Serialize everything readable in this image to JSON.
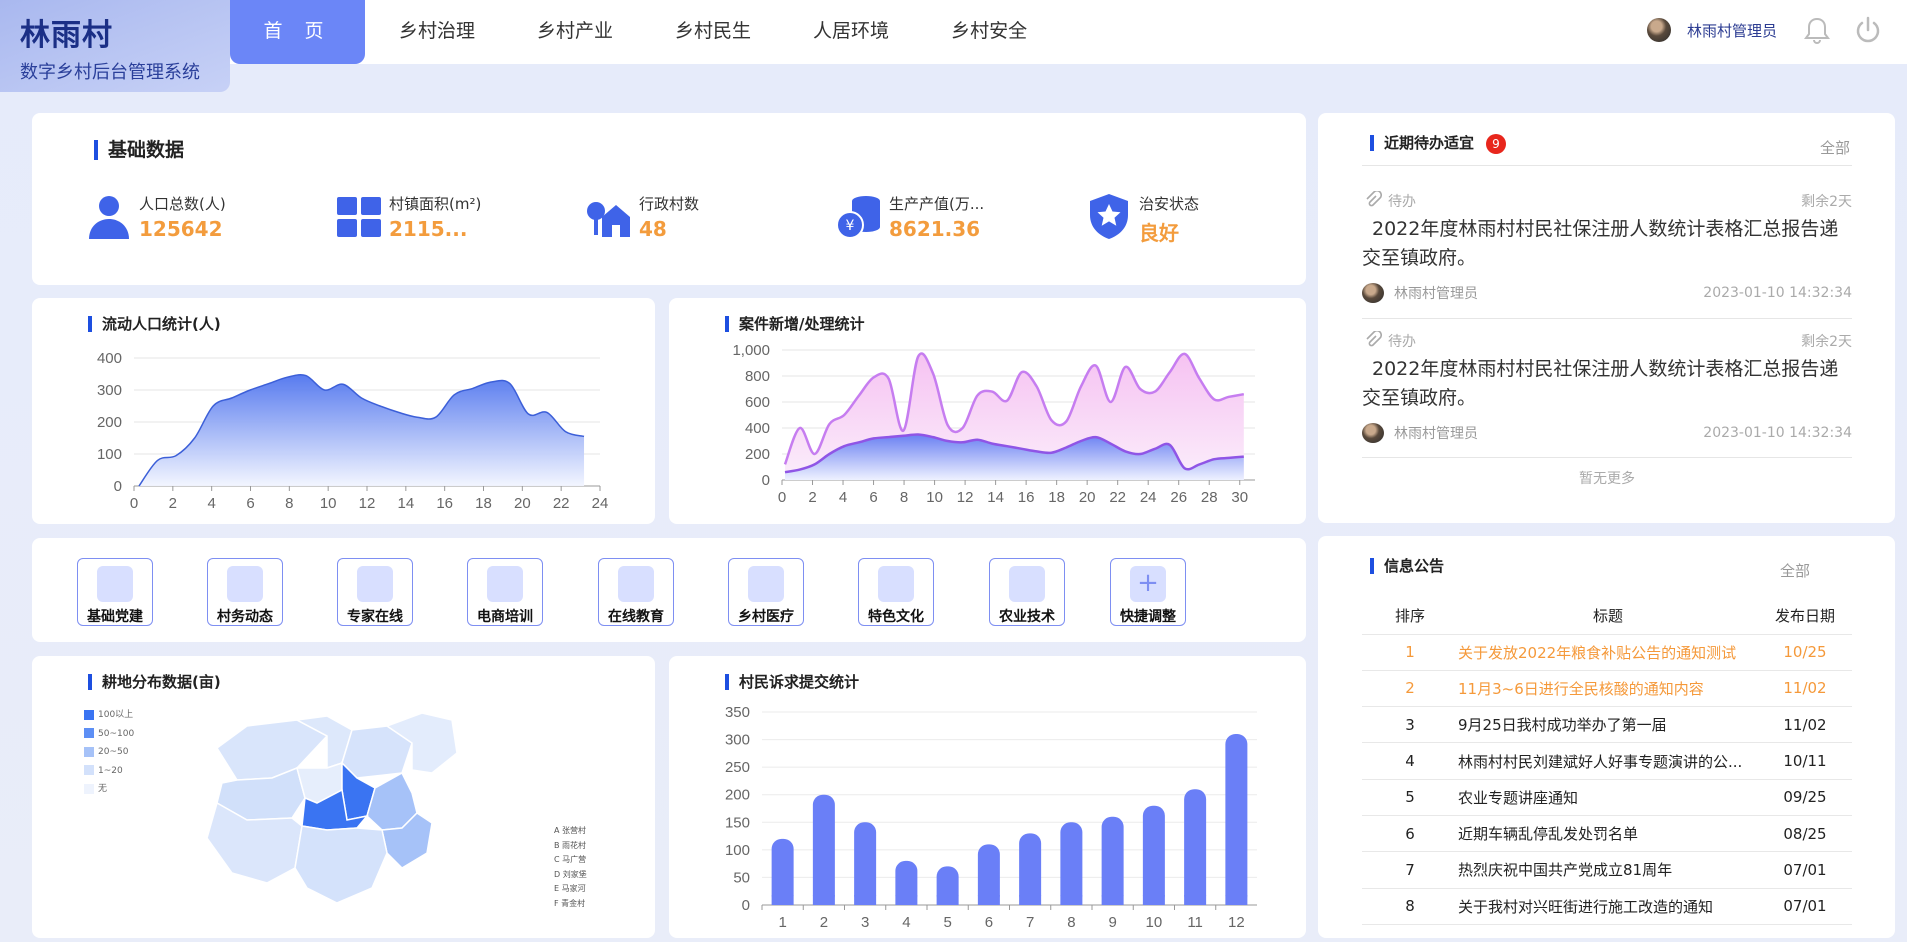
{
  "brand": {
    "title": "林雨村",
    "subtitle": "数字乡村后台管理系统"
  },
  "nav": [
    "首 页",
    "乡村治理",
    "乡村产业",
    "乡村民生",
    "人居环境",
    "乡村安全"
  ],
  "user": {
    "name": "林雨村管理员"
  },
  "basic": {
    "title": "基础数据",
    "stats": [
      {
        "label": "人口总数(人)",
        "value": "125642"
      },
      {
        "label": "村镇面积(m²)",
        "value": "2115..."
      },
      {
        "label": "行政村数",
        "value": "48"
      },
      {
        "label": "生产产值(万...",
        "value": "8621.36"
      },
      {
        "label": "治安状态",
        "value": "良好"
      }
    ]
  },
  "chart1": {
    "title": "流动人口统计(人)"
  },
  "chart2": {
    "title": "案件新增/处理统计"
  },
  "chart3": {
    "title": "耕地分布数据(亩)",
    "legend": [
      "100以上",
      "50~100",
      "20~50",
      "1~20",
      "无"
    ],
    "villages": [
      "A  张营村",
      "B  雨花村",
      "C  马广营",
      "D  刘家堡",
      "E  马家河",
      "F  青金村"
    ]
  },
  "chart4": {
    "title": "村民诉求提交统计"
  },
  "quick": [
    "基础党建",
    "村务动态",
    "专家在线",
    "电商培训",
    "在线教育",
    "乡村医疗",
    "特色文化",
    "农业技术",
    "快捷调整"
  ],
  "todo": {
    "title": "近期待办适宜",
    "badge": "9",
    "all": "全部",
    "no_more": "暂无更多",
    "items": [
      {
        "status": "待办",
        "remain": "剩余2天",
        "text": "2022年度林雨村村民社保注册人数统计表格汇总报告递交至镇政府。",
        "owner": "林雨村管理员",
        "time": "2023-01-10 14:32:34"
      },
      {
        "status": "待办",
        "remain": "剩余2天",
        "text": "2022年度林雨村村民社保注册人数统计表格汇总报告递交至镇政府。",
        "owner": "林雨村管理员",
        "time": "2023-01-10 14:32:34"
      }
    ]
  },
  "notice": {
    "title": "信息公告",
    "all": "全部",
    "headers": [
      "排序",
      "标题",
      "发布日期"
    ],
    "rows": [
      {
        "n": "1",
        "title": "关于发放2022年粮食补贴公告的通知测试",
        "date": "10/25"
      },
      {
        "n": "2",
        "title": "11月3~6日进行全民核酸的通知内容",
        "date": "11/02"
      },
      {
        "n": "3",
        "title": "9月25日我村成功举办了第一届",
        "date": "11/02"
      },
      {
        "n": "4",
        "title": "林雨村村民刘建斌好人好事专题演讲的公...",
        "date": "10/11"
      },
      {
        "n": "5",
        "title": "农业专题讲座通知",
        "date": "09/25"
      },
      {
        "n": "6",
        "title": "近期车辆乱停乱发处罚名单",
        "date": "08/25"
      },
      {
        "n": "7",
        "title": "热烈庆祝中国共产党成立81周年",
        "date": "07/01"
      },
      {
        "n": "8",
        "title": "关于我村对兴旺街进行施工改造的通知",
        "date": "07/01"
      }
    ]
  },
  "colors": {
    "accent": "#6b86f7",
    "orange": "#f39c3d",
    "bar": "#6a7ff7",
    "title_bar": "#1d4fe0"
  },
  "chart_data": [
    {
      "type": "area",
      "title": "流动人口统计(人)",
      "x": [
        0,
        1,
        2,
        3,
        4,
        5,
        6,
        7,
        8,
        9,
        10,
        11,
        12,
        13,
        14,
        15,
        16,
        17,
        18,
        19,
        20,
        21,
        22,
        23,
        24
      ],
      "values": [
        0,
        80,
        95,
        150,
        250,
        275,
        300,
        320,
        340,
        345,
        300,
        318,
        275,
        250,
        230,
        215,
        215,
        285,
        305,
        325,
        320,
        225,
        230,
        170,
        155
      ],
      "ylim": [
        0,
        400
      ],
      "yticks": [
        0,
        100,
        200,
        300,
        400
      ],
      "xticks": [
        0,
        2,
        4,
        6,
        8,
        10,
        12,
        14,
        16,
        18,
        20,
        22,
        24
      ]
    },
    {
      "type": "area",
      "title": "案件新增/处理统计",
      "x": [
        0,
        1,
        2,
        3,
        4,
        5,
        6,
        7,
        8,
        9,
        10,
        11,
        12,
        13,
        14,
        15,
        16,
        17,
        18,
        19,
        20,
        21,
        22,
        23,
        24,
        25,
        26,
        27,
        28,
        29,
        30,
        31
      ],
      "series": [
        {
          "values": [
            120,
            400,
            200,
            430,
            500,
            650,
            790,
            780,
            380,
            950,
            820,
            420,
            400,
            650,
            680,
            610,
            830,
            720,
            460,
            450,
            720,
            880,
            600,
            870,
            700,
            680,
            830,
            970,
            780,
            620,
            640,
            660
          ]
        },
        {
          "values": [
            60,
            80,
            120,
            200,
            260,
            290,
            320,
            330,
            340,
            350,
            330,
            300,
            290,
            310,
            280,
            260,
            240,
            220,
            210,
            250,
            300,
            330,
            280,
            220,
            200,
            240,
            270,
            90,
            120,
            160,
            170,
            180
          ]
        }
      ],
      "ylim": [
        0,
        1000
      ],
      "yticks": [
        "0",
        "200",
        "400",
        "600",
        "800",
        "1,000"
      ],
      "xticks": [
        0,
        2,
        4,
        6,
        8,
        10,
        12,
        14,
        16,
        18,
        20,
        22,
        24,
        26,
        28,
        30
      ]
    },
    {
      "type": "bar",
      "title": "村民诉求提交统计",
      "categories": [
        "1",
        "2",
        "3",
        "4",
        "5",
        "6",
        "7",
        "8",
        "9",
        "10",
        "11",
        "12"
      ],
      "values": [
        120,
        200,
        150,
        80,
        70,
        110,
        130,
        150,
        160,
        180,
        210,
        310
      ],
      "ylim": [
        0,
        350
      ],
      "yticks": [
        0,
        50,
        100,
        150,
        200,
        250,
        300,
        350
      ]
    }
  ]
}
